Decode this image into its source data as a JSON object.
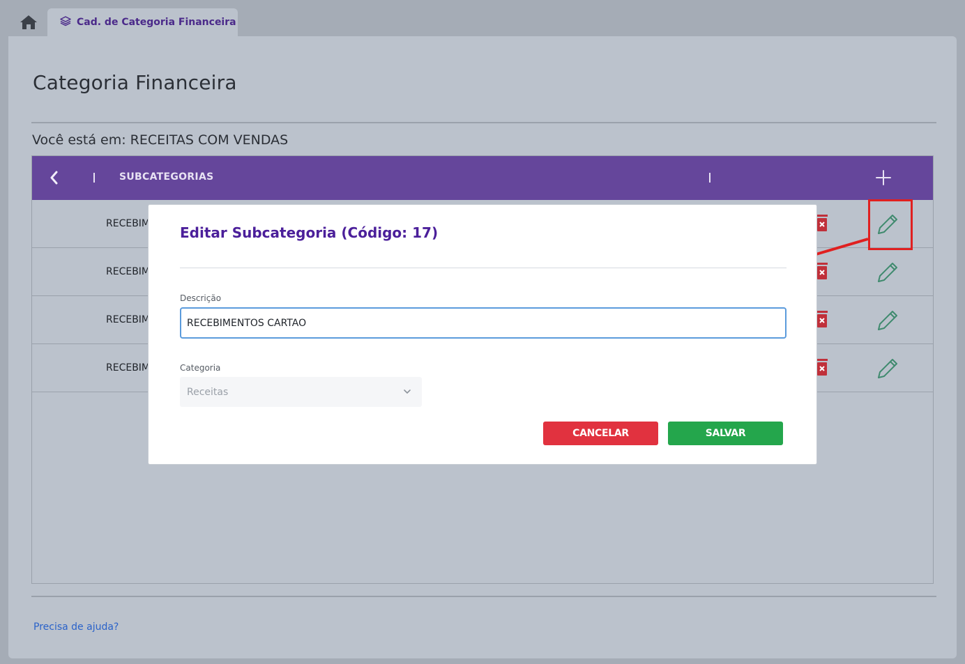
{
  "tabs": [
    {
      "label": "Cad. de Categoria Financeira",
      "icon": "layers-icon"
    }
  ],
  "page": {
    "title": "Categoria Financeira",
    "breadcrumb": "Você está em: RECEITAS COM VENDAS",
    "help_link": "Precisa de ajuda?"
  },
  "table": {
    "header_label": "SUBCATEGORIAS",
    "rows": [
      {
        "label": "RECEBIM"
      },
      {
        "label": "RECEBIM"
      },
      {
        "label": "RECEBIM"
      },
      {
        "label": "RECEBIM"
      }
    ]
  },
  "modal": {
    "title": "Editar Subcategoria (Código: 17)",
    "description_label": "Descrição",
    "description_value": "RECEBIMENTOS CARTAO",
    "category_label": "Categoria",
    "category_value": "Receitas",
    "cancel_label": "CANCELAR",
    "save_label": "SALVAR"
  },
  "colors": {
    "header": "#65469b",
    "accent_title": "#4b1f9a",
    "cancel": "#e1323f",
    "save": "#24a64c",
    "trash": "#c0303a",
    "edit": "#3f8a6e",
    "highlight": "#e02020"
  }
}
